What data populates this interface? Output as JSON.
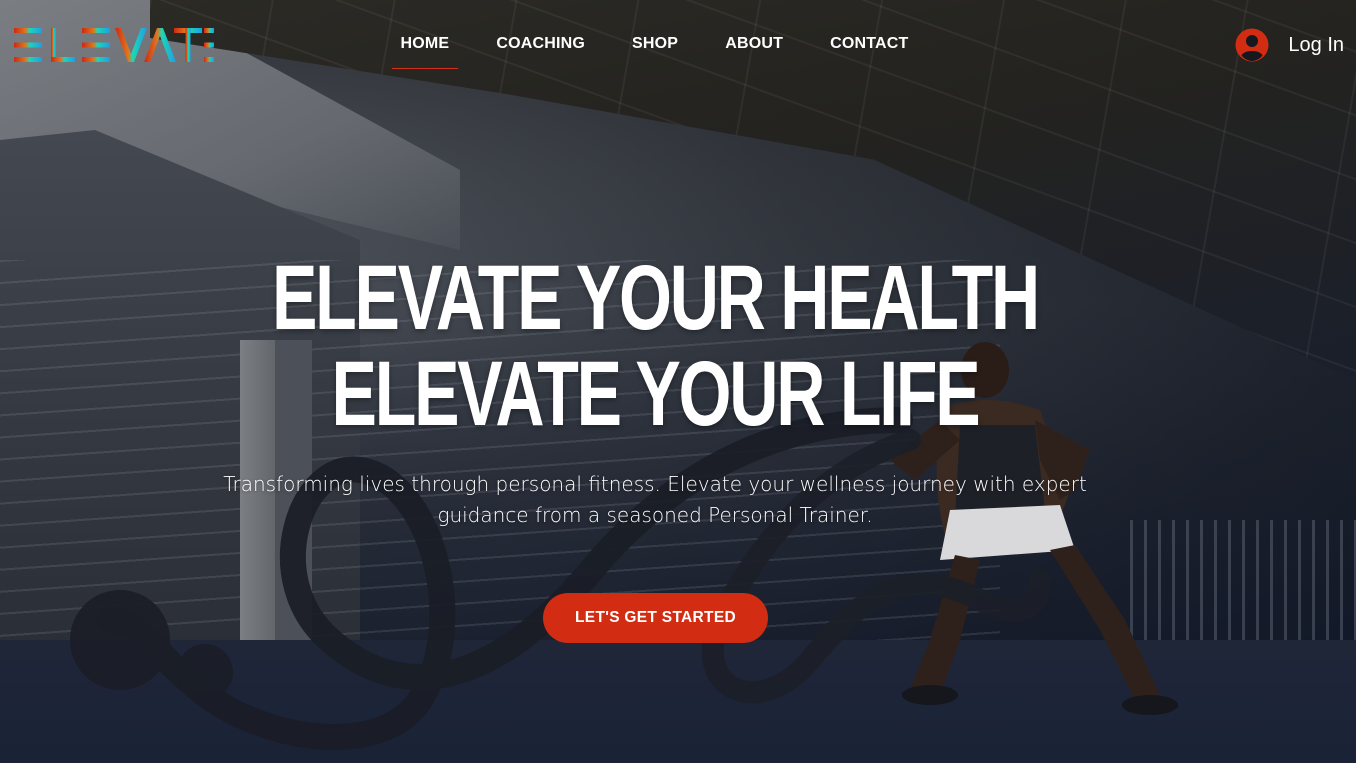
{
  "brand": {
    "name": "ELEVATE",
    "colors": {
      "orange": "#e0531e",
      "red": "#cc2a12",
      "teal": "#1fd6b4",
      "blue": "#1d9ee6"
    }
  },
  "nav": {
    "items": [
      {
        "label": "HOME",
        "active": true
      },
      {
        "label": "COACHING",
        "active": false
      },
      {
        "label": "SHOP",
        "active": false
      },
      {
        "label": "ABOUT",
        "active": false
      },
      {
        "label": "CONTACT",
        "active": false
      }
    ],
    "active_color": "#d4311a"
  },
  "login": {
    "label": "Log In",
    "icon": "user-circle-icon",
    "icon_color": "#d22c12"
  },
  "hero": {
    "headline_line1": "ELEVATE YOUR HEALTH",
    "headline_line2": "ELEVATE YOUR LIFE",
    "subtitle_line1": "Transforming lives through personal fitness. Elevate your wellness journey with expert",
    "subtitle_line2": "guidance from a seasoned Personal Trainer.",
    "cta_label": "LET'S GET STARTED",
    "cta_color": "#d22c12"
  }
}
